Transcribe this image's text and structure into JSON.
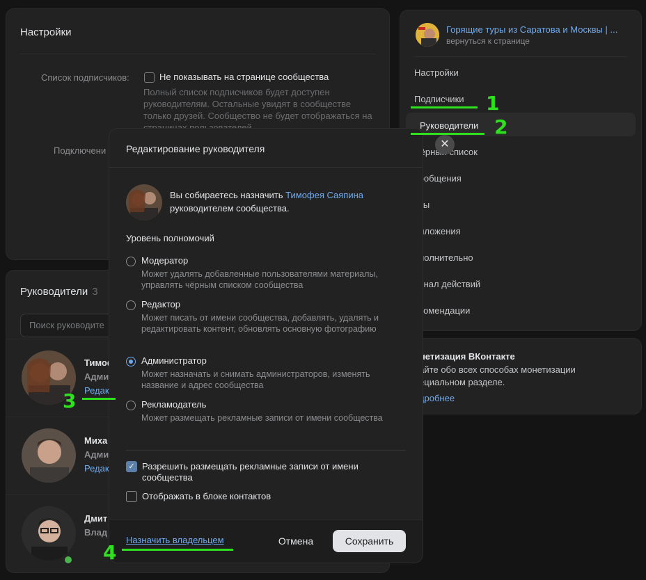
{
  "settings": {
    "title": "Настройки",
    "subscribers_label": "Список подписчиков:",
    "hide_checkbox_label": "Не показывать на странице сообщества",
    "hide_description": "Полный список подписчиков будет доступен руководителям. Остальные увидят в сообществе только друзей. Сообщество не будет отображаться на страницах пользователей",
    "connection_label": "Подключени"
  },
  "managers": {
    "title": "Руководители",
    "count": "3",
    "search_placeholder": "Поиск руководите",
    "rows": [
      {
        "name": "Тимоф",
        "role": "Адми",
        "edit": "Редак"
      },
      {
        "name": "Миха",
        "role": "Адми",
        "edit": "Редак"
      },
      {
        "name": "Дмит",
        "role": "Влад",
        "edit": ""
      }
    ]
  },
  "nav": {
    "group_name": "Горящие туры из Саратова и Москвы | ...",
    "back_label": "вернуться к странице",
    "items": [
      "Настройки",
      "Подписчики",
      "Руководители",
      "Чёрный список",
      "сообщения",
      "аты",
      "риложения",
      "ополнительно",
      "урнал действий",
      "екомендации"
    ],
    "active_index": 2
  },
  "monetization": {
    "title": "онетизация ВКонтакте",
    "description": "найте обо всех способах монетизации пециальном разделе.",
    "link": "одробнее"
  },
  "modal": {
    "title": "Редактирование руководителя",
    "intro_prefix": "Вы собираетесь назначить ",
    "intro_name": "Тимофея Саяпина",
    "intro_suffix": " руководителем сообщества.",
    "level_title": "Уровень полномочий",
    "roles": [
      {
        "label": "Модератор",
        "desc": "Может удалять добавленные пользователями материалы, управлять чёрным списком сообщества",
        "selected": false
      },
      {
        "label": "Редактор",
        "desc": "Может писать от имени сообщества, добавлять, удалять и редактировать контент, обновлять основную фотографию",
        "selected": false
      },
      {
        "label": "Администратор",
        "desc": "Может назначать и снимать администраторов, изменять название и адрес сообщества",
        "selected": true
      },
      {
        "label": "Рекламодатель",
        "desc": "Может размещать рекламные записи от имени сообщества",
        "selected": false
      }
    ],
    "allow_ads_label": "Разрешить размещать рекламные записи от имени сообщества",
    "allow_ads_checked": true,
    "show_contacts_label": "Отображать в блоке контактов",
    "show_contacts_checked": false,
    "owner_link": "Назначить владельцем",
    "cancel": "Отмена",
    "save": "Сохранить"
  },
  "close_glyph": "✕",
  "annotations": [
    "1",
    "2",
    "3",
    "4"
  ],
  "colors": {
    "accent": "#71aaeb",
    "annotation": "#2fe01e",
    "background": "#141414",
    "card": "#222222"
  }
}
